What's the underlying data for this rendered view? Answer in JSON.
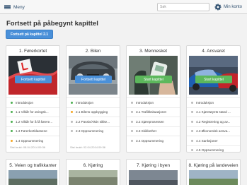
{
  "header": {
    "menu_label": "Meny",
    "search_placeholder": "Søk",
    "account_label": "Min konto"
  },
  "page": {
    "title": "Fortsett på påbegynt kapittel",
    "continue_button": "Fortsett på kapittel 2.1"
  },
  "colors": {
    "accent": "#4a90d9",
    "start_green": "#5cb85c",
    "done": "#4caf50",
    "in_progress": "#f5a623",
    "not_started": "#b9b9b9"
  },
  "chapters": [
    {
      "title": "1. Førerkortet",
      "button": "Fortsett kapittel",
      "items": [
        {
          "label": "Introduksjon",
          "status": "done"
        },
        {
          "label": "1.1 Vilkår for øvingsk...",
          "status": "done"
        },
        {
          "label": "1.2 Vilkår for å få førere...",
          "status": "done"
        },
        {
          "label": "1.3 Førerkortklassene",
          "status": "done"
        },
        {
          "label": "1.4 Oppsummering",
          "status": "in_progress"
        }
      ],
      "date": "Sist brukt: 08.04.2014 09:36"
    },
    {
      "title": "2. Bilen",
      "button": "Fortsett kapittel",
      "items": [
        {
          "label": "Introduksjon",
          "status": "done"
        },
        {
          "label": "2.1 Bilens oppbygging",
          "status": "in_progress"
        },
        {
          "label": "2.2 Passiv/Aktiv sikke...",
          "status": "not_started"
        },
        {
          "label": "2.3 Oppsummering",
          "status": "not_started"
        }
      ],
      "date": "Sist brukt: 02.04.2014 09:36"
    },
    {
      "title": "3. Mennesket",
      "button": "Start kapittel",
      "items": [
        {
          "label": "Introduksjon",
          "status": "not_started"
        },
        {
          "label": "3.1 Trafikksituasjoner",
          "status": "not_started"
        },
        {
          "label": "3.2 Sjøreprosessen",
          "status": "not_started"
        },
        {
          "label": "3.3 Skikkethet",
          "status": "not_started"
        },
        {
          "label": "3.4 Oppsummering",
          "status": "not_started"
        }
      ],
      "date": ""
    },
    {
      "title": "4. Ansvaret",
      "button": "Start kapittel",
      "items": [
        {
          "label": "Introduksjon",
          "status": "not_started"
        },
        {
          "label": "4.1 Kjøretøyets stand ...",
          "status": "not_started"
        },
        {
          "label": "4.2 Registrering og av...",
          "status": "not_started"
        },
        {
          "label": "4.3 Økonomisk ansva...",
          "status": "not_started"
        },
        {
          "label": "4.4 Sanksjoner",
          "status": "not_started"
        },
        {
          "label": "4.5 Oppsummering",
          "status": "not_started"
        }
      ],
      "date": ""
    }
  ],
  "chapters_row2": [
    {
      "title": "5. Veien og trafikkanter"
    },
    {
      "title": "6. Kjøring"
    },
    {
      "title": "7. Kjøring i byen"
    },
    {
      "title": "8. Kjøring på landeveien"
    }
  ]
}
